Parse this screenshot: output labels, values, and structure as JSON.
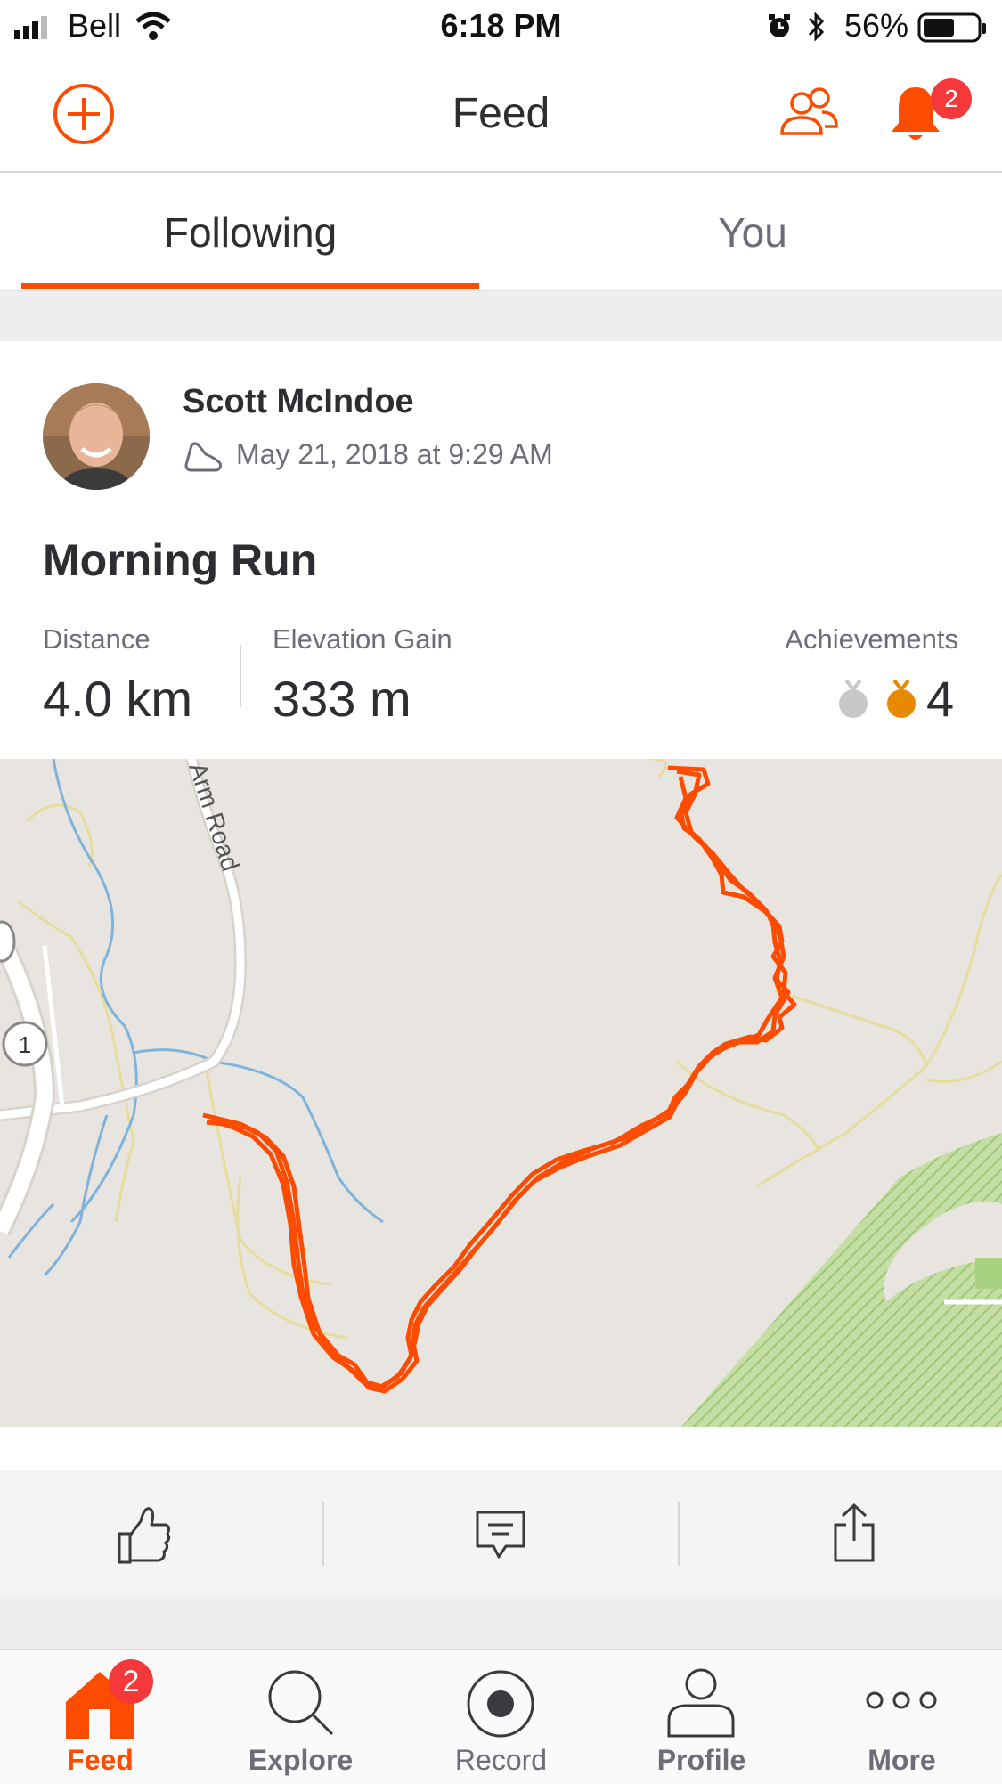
{
  "status_bar": {
    "carrier": "Bell",
    "time": "6:18 PM",
    "battery": "56%"
  },
  "header": {
    "title": "Feed",
    "notification_count": "2"
  },
  "tabs": [
    {
      "label": "Following",
      "active": true
    },
    {
      "label": "You",
      "active": false
    }
  ],
  "activity": {
    "athlete": "Scott McIndoe",
    "date": "May 21, 2018 at 9:29 AM",
    "title": "Morning Run",
    "stats": {
      "distance_label": "Distance",
      "distance_value": "4.0 km",
      "elevation_label": "Elevation Gain",
      "elevation_value": "333 m",
      "achievements_label": "Achievements",
      "achievements_value": "4"
    },
    "map": {
      "road_label": "Arm Road",
      "route_marker": "1"
    }
  },
  "tab_bar": {
    "items": [
      {
        "label": "Feed",
        "active": true,
        "badge": "2"
      },
      {
        "label": "Explore"
      },
      {
        "label": "Record"
      },
      {
        "label": "Profile"
      },
      {
        "label": "More"
      }
    ]
  },
  "colors": {
    "accent": "#fc4c02",
    "badge": "#f5383a",
    "map_bg": "#e8e4df",
    "park": "#a8d27f",
    "water": "#7fb3dc"
  },
  "icons": [
    "signal-icon",
    "wifi-icon",
    "alarm-icon",
    "bluetooth-icon",
    "battery-icon",
    "add-icon",
    "people-icon",
    "bell-icon",
    "run-shoe-icon",
    "silver-medal-icon",
    "gold-medal-icon",
    "thumbs-up-icon",
    "comment-icon",
    "share-icon",
    "home-icon",
    "search-icon",
    "record-icon",
    "profile-icon",
    "more-icon"
  ]
}
